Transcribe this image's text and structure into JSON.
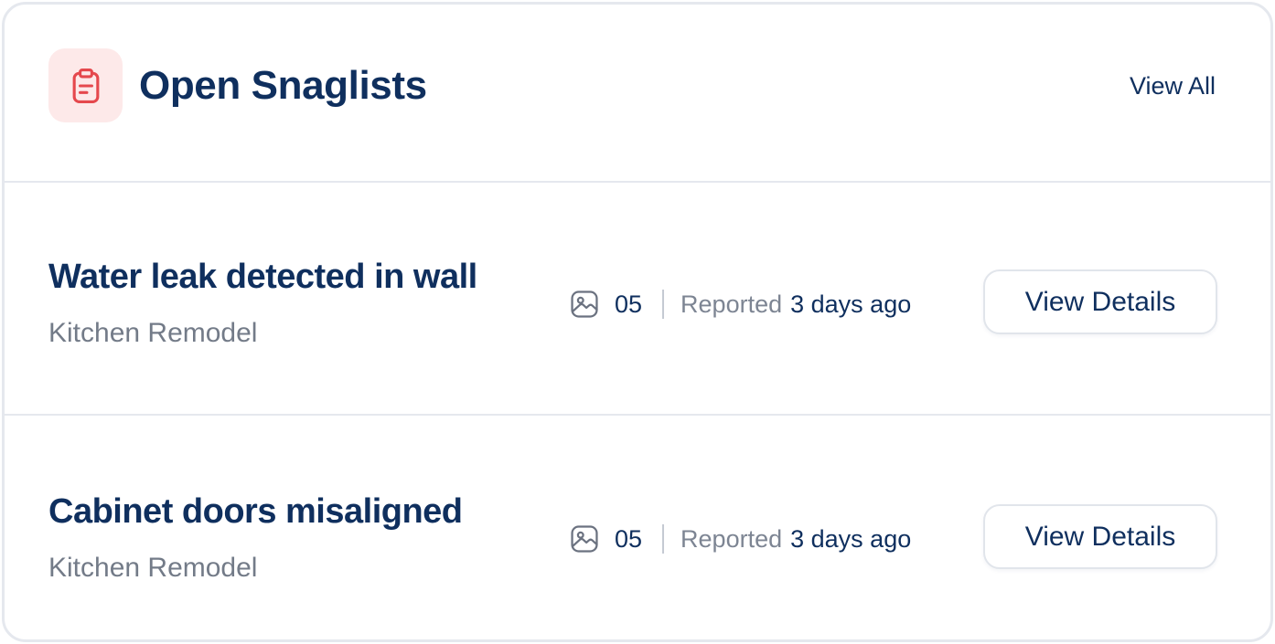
{
  "header": {
    "icon": "clipboard-icon",
    "title": "Open Snaglists",
    "view_all_label": "View All"
  },
  "colors": {
    "heading": "#0f2f5e",
    "muted": "#737b88",
    "icon_accent": "#e5484d",
    "icon_bg": "#fde9e9",
    "border": "#e5e8ee"
  },
  "snags": [
    {
      "title": "Water leak detected in wall",
      "project": "Kitchen Remodel",
      "photo_icon": "image-icon",
      "photo_count": "05",
      "reported_label": "Reported",
      "reported_time": "3 days ago",
      "button_label": "View Details"
    },
    {
      "title": "Cabinet doors misaligned",
      "project": "Kitchen Remodel",
      "photo_icon": "image-icon",
      "photo_count": "05",
      "reported_label": "Reported",
      "reported_time": "3 days ago",
      "button_label": "View Details"
    }
  ]
}
